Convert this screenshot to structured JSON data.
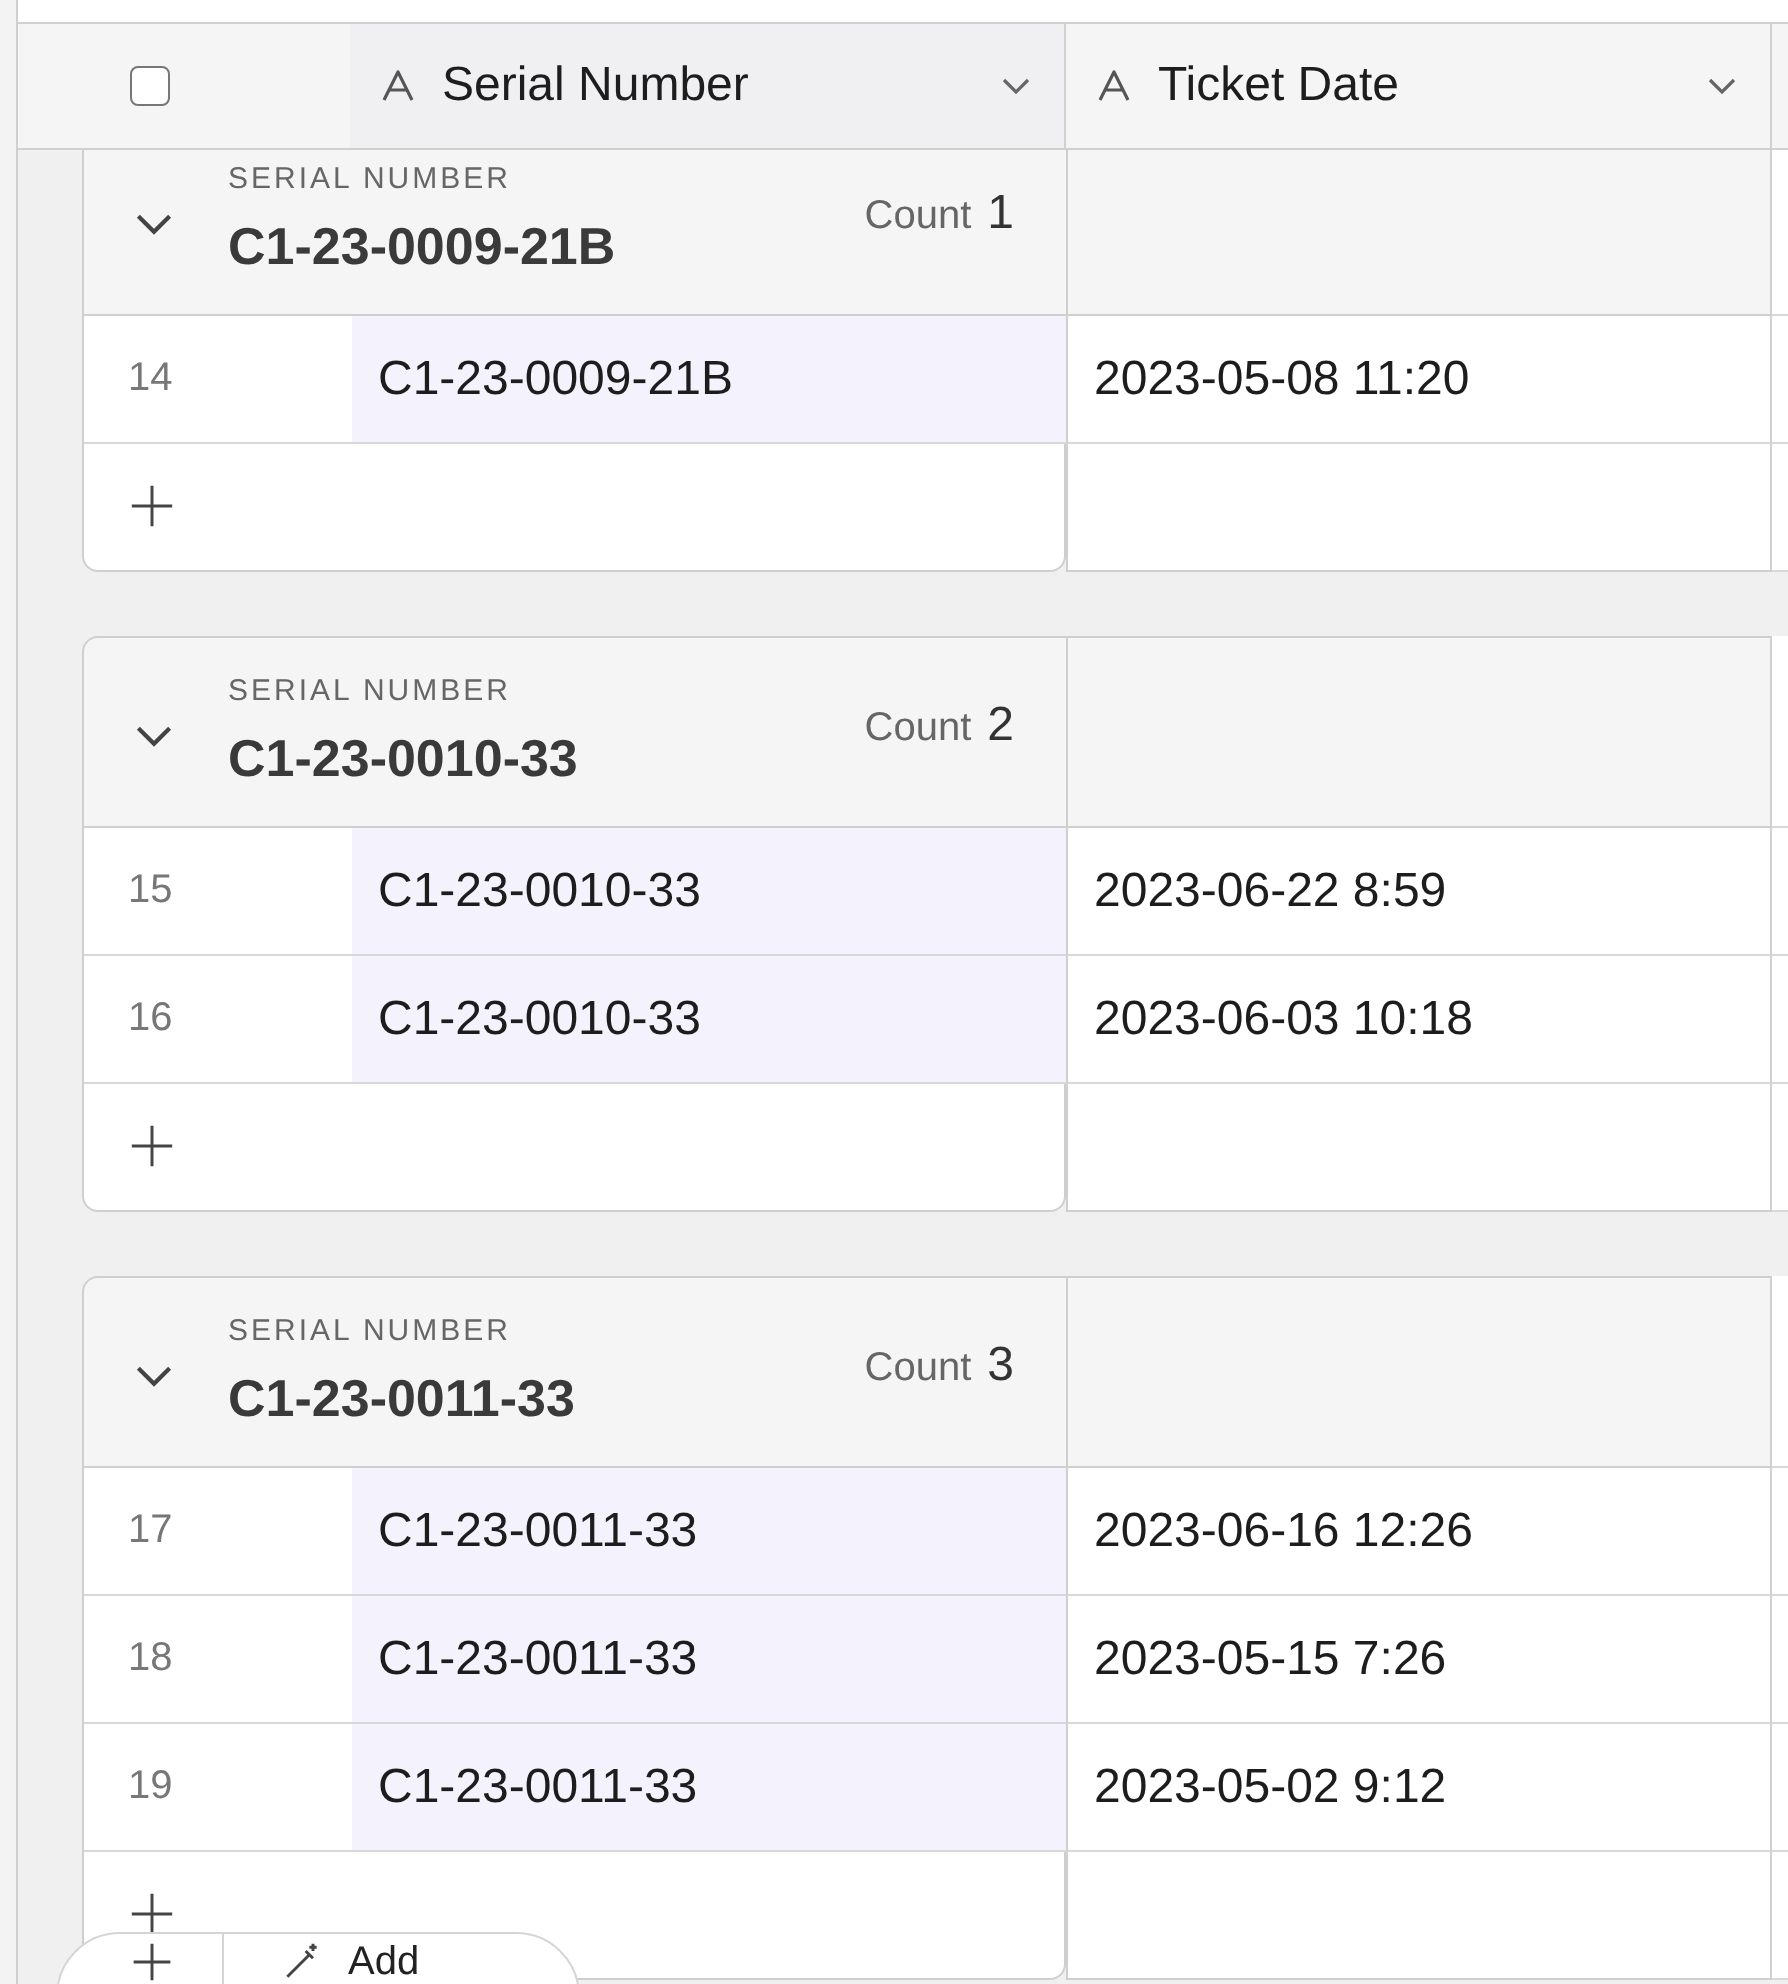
{
  "header": {
    "select_all": {
      "checked": false
    },
    "columns": [
      {
        "name": "Serial Number"
      },
      {
        "name": "Ticket Date"
      }
    ]
  },
  "groups": [
    {
      "field_label": "SERIAL NUMBER",
      "value": "C1-23-0009-21B",
      "count_label": "Count",
      "count": "1",
      "expanded": true,
      "rows": [
        {
          "number": "14",
          "serial": "C1-23-0009-21B",
          "ticket_date": "2023-05-08 11:20"
        }
      ]
    },
    {
      "field_label": "SERIAL NUMBER",
      "value": "C1-23-0010-33",
      "count_label": "Count",
      "count": "2",
      "expanded": true,
      "rows": [
        {
          "number": "15",
          "serial": "C1-23-0010-33",
          "ticket_date": "2023-06-22 8:59"
        },
        {
          "number": "16",
          "serial": "C1-23-0010-33",
          "ticket_date": "2023-06-03 10:18"
        }
      ]
    },
    {
      "field_label": "SERIAL NUMBER",
      "value": "C1-23-0011-33",
      "count_label": "Count",
      "count": "3",
      "expanded": true,
      "rows": [
        {
          "number": "17",
          "serial": "C1-23-0011-33",
          "ticket_date": "2023-06-16 12:26"
        },
        {
          "number": "18",
          "serial": "C1-23-0011-33",
          "ticket_date": "2023-05-15 7:26"
        },
        {
          "number": "19",
          "serial": "C1-23-0011-33",
          "ticket_date": "2023-05-02 9:12"
        }
      ]
    }
  ],
  "floating_bar": {
    "add_label": "Add"
  }
}
